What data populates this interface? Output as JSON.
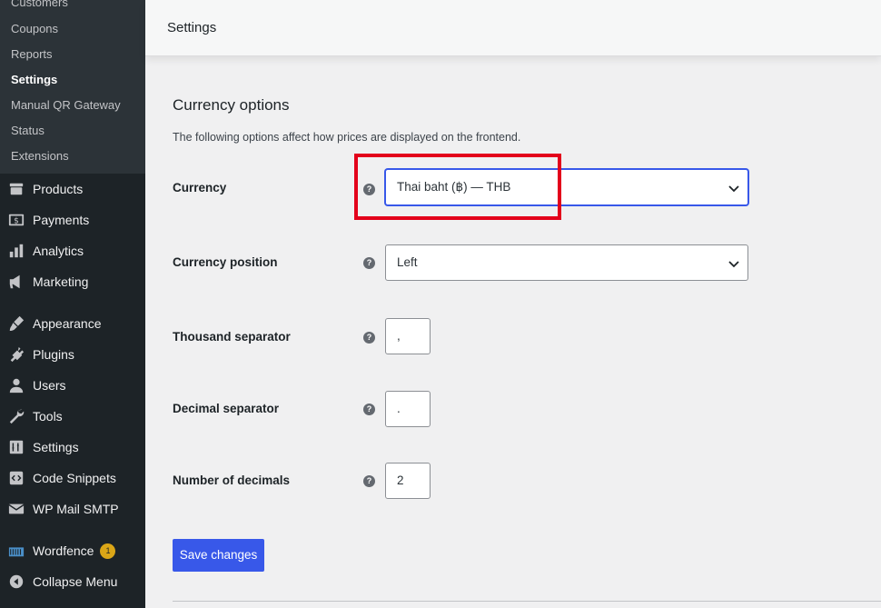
{
  "sidebar": {
    "submenu": [
      {
        "label": "Customers"
      },
      {
        "label": "Coupons"
      },
      {
        "label": "Reports"
      },
      {
        "label": "Settings"
      },
      {
        "label": "Manual QR Gateway"
      },
      {
        "label": "Status"
      },
      {
        "label": "Extensions"
      }
    ],
    "menu": [
      {
        "label": "Products",
        "icon": "products-icon"
      },
      {
        "label": "Payments",
        "icon": "payments-icon"
      },
      {
        "label": "Analytics",
        "icon": "analytics-icon"
      },
      {
        "label": "Marketing",
        "icon": "marketing-icon"
      },
      {
        "label": "Appearance",
        "icon": "appearance-icon"
      },
      {
        "label": "Plugins",
        "icon": "plugins-icon"
      },
      {
        "label": "Users",
        "icon": "users-icon"
      },
      {
        "label": "Tools",
        "icon": "tools-icon"
      },
      {
        "label": "Settings",
        "icon": "settings-icon"
      },
      {
        "label": "Code Snippets",
        "icon": "code-snippets-icon"
      },
      {
        "label": "WP Mail SMTP",
        "icon": "mail-icon"
      },
      {
        "label": "Wordfence",
        "icon": "wordfence-icon",
        "badge": "1"
      },
      {
        "label": "Collapse Menu",
        "icon": "collapse-icon"
      }
    ]
  },
  "header": {
    "title": "Settings"
  },
  "main": {
    "section_title": "Currency options",
    "section_desc": "The following options affect how prices are displayed on the frontend.",
    "fields": {
      "currency": {
        "label": "Currency",
        "value": "Thai baht (฿) — THB"
      },
      "currency_position": {
        "label": "Currency position",
        "value": "Left"
      },
      "thousand_separator": {
        "label": "Thousand separator",
        "value": ","
      },
      "decimal_separator": {
        "label": "Decimal separator",
        "value": "."
      },
      "number_of_decimals": {
        "label": "Number of decimals",
        "value": "2"
      }
    },
    "help_glyph": "?",
    "save_label": "Save changes"
  },
  "colors": {
    "accent": "#3858e9",
    "highlight": "#e3001b",
    "sidebar_bg": "#1d2327",
    "badge": "#dba617"
  }
}
